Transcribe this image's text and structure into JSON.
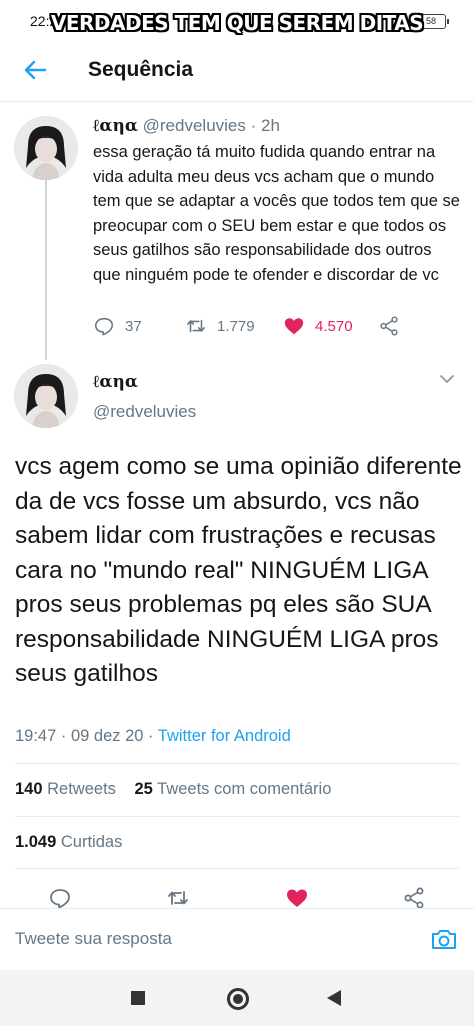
{
  "status_bar": {
    "time": "22:25",
    "icons_text": "✉ ◇ ▢",
    "battery": "58"
  },
  "overlay": {
    "caption": "VERDADES TEM QUE SEREM DITAS"
  },
  "header": {
    "title": "Sequência"
  },
  "tweet_parent": {
    "display_name": "ℓαηα",
    "handle": "@redveluvies",
    "separator": "·",
    "time": "2h",
    "text": "essa geração tá muito fudida quando entrar na vida adulta meu deus vcs acham que o mundo tem que se adaptar a vocês que todos tem que se preocupar com o SEU bem estar e que todos os seus gatilhos são responsabilidade dos outros que ninguém pode te ofender e discordar de vc",
    "replies": "37",
    "retweets": "1.779",
    "likes": "4.570"
  },
  "tweet_main": {
    "display_name": "ℓαηα",
    "handle": "@redveluvies",
    "text": "vcs agem como se uma opinião diferente da de vcs fosse um absurdo, vcs não sabem lidar com frustrações e recusas cara no \"mundo real\" NINGUÉM LIGA pros seus problemas pq eles são SUA responsabilidade NINGUÉM LIGA pros seus gatilhos",
    "timestamp": "19:47 · 09 dez 20 · ",
    "via": "Twitter for Android",
    "retweet_count": "140",
    "retweet_label": "Retweets",
    "quote_count": "25",
    "quote_label": "Tweets com comentário",
    "like_count": "1.049",
    "like_label": "Curtidas"
  },
  "reply_bar": {
    "placeholder": "Tweete sua resposta"
  },
  "colors": {
    "accent": "#1da1f2",
    "like": "#e0245e",
    "secondary_text": "#657786",
    "divider": "#e6ecf0"
  },
  "icons": [
    "back-arrow-icon",
    "chevron-down-icon",
    "reply-icon",
    "retweet-icon",
    "heart-icon",
    "share-icon",
    "camera-icon",
    "nav-square-icon",
    "nav-circle-icon",
    "nav-back-triangle-icon"
  ]
}
